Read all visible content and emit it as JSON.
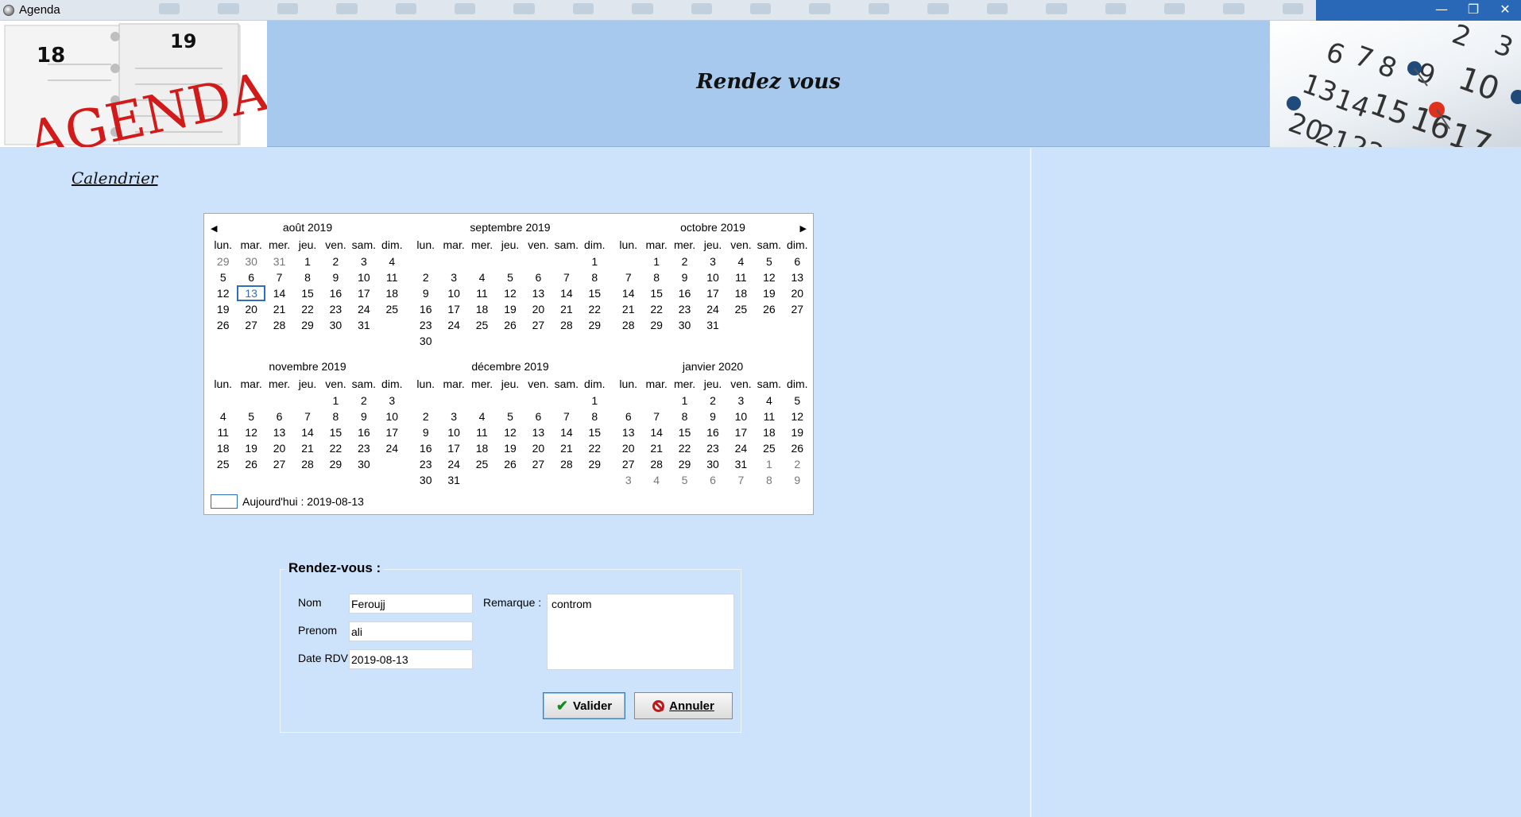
{
  "window": {
    "title": "Agenda",
    "controls": [
      "—",
      "❐",
      "✕"
    ]
  },
  "header": {
    "title": "Rendez vous",
    "logo_text": "AGENDA",
    "logo_dates": [
      "18",
      "19"
    ]
  },
  "calendar": {
    "link_label": "Calendrier ",
    "weekdays": [
      "lun.",
      "mar.",
      "mer.",
      "jeu.",
      "ven.",
      "sam.",
      "dim."
    ],
    "months": [
      {
        "title": "août 2019",
        "offset": 0,
        "pre": [
          29,
          30,
          31
        ],
        "days": 31,
        "post": 0
      },
      {
        "title": "septembre 2019",
        "offset": 6,
        "pre": [],
        "days": 30,
        "post": 0
      },
      {
        "title": "octobre 2019",
        "offset": 1,
        "pre": [],
        "days": 31,
        "post": 0
      },
      {
        "title": "novembre 2019",
        "offset": 4,
        "pre": [],
        "days": 30,
        "post": 0
      },
      {
        "title": "décembre 2019",
        "offset": 6,
        "pre": [],
        "days": 31,
        "post": 0
      },
      {
        "title": "janvier 2020",
        "offset": 2,
        "pre": [],
        "days": 31,
        "post": 9
      }
    ],
    "selected": {
      "month": 0,
      "day": 13
    },
    "today_label": "Aujourd'hui : 2019-08-13"
  },
  "form": {
    "legend": "Rendez-vous :",
    "nom_label": "Nom",
    "nom_value": "Feroujj",
    "prenom_label": "Prenom",
    "prenom_value": "ali",
    "date_label": "Date RDV",
    "date_value": "2019-08-13",
    "remarque_label": "Remarque :",
    "remarque_value": "controm",
    "valider_label": "Valider",
    "annuler_label": "Annuler"
  },
  "colors": {
    "background": "#cde3fb",
    "header": "#a7c9ed",
    "accent": "#2c6fc0"
  }
}
